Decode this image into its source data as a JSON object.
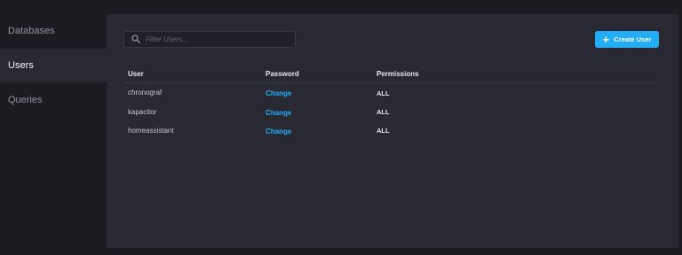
{
  "sidebar": {
    "items": [
      {
        "label": "Databases"
      },
      {
        "label": "Users"
      },
      {
        "label": "Queries"
      }
    ]
  },
  "toolbar": {
    "filter_placeholder": "Filter Users...",
    "create_label": "Create User"
  },
  "table": {
    "headers": [
      "User",
      "Password",
      "Permissions"
    ],
    "rows": [
      {
        "user": "chronograf",
        "password": "Change",
        "permissions": "ALL"
      },
      {
        "user": "kapacitor",
        "password": "Change",
        "permissions": "ALL"
      },
      {
        "user": "homeassistant",
        "password": "Change",
        "permissions": "ALL"
      }
    ]
  },
  "colors": {
    "accent": "#22adf6",
    "background": "#1c1c23",
    "panel": "#292933"
  }
}
